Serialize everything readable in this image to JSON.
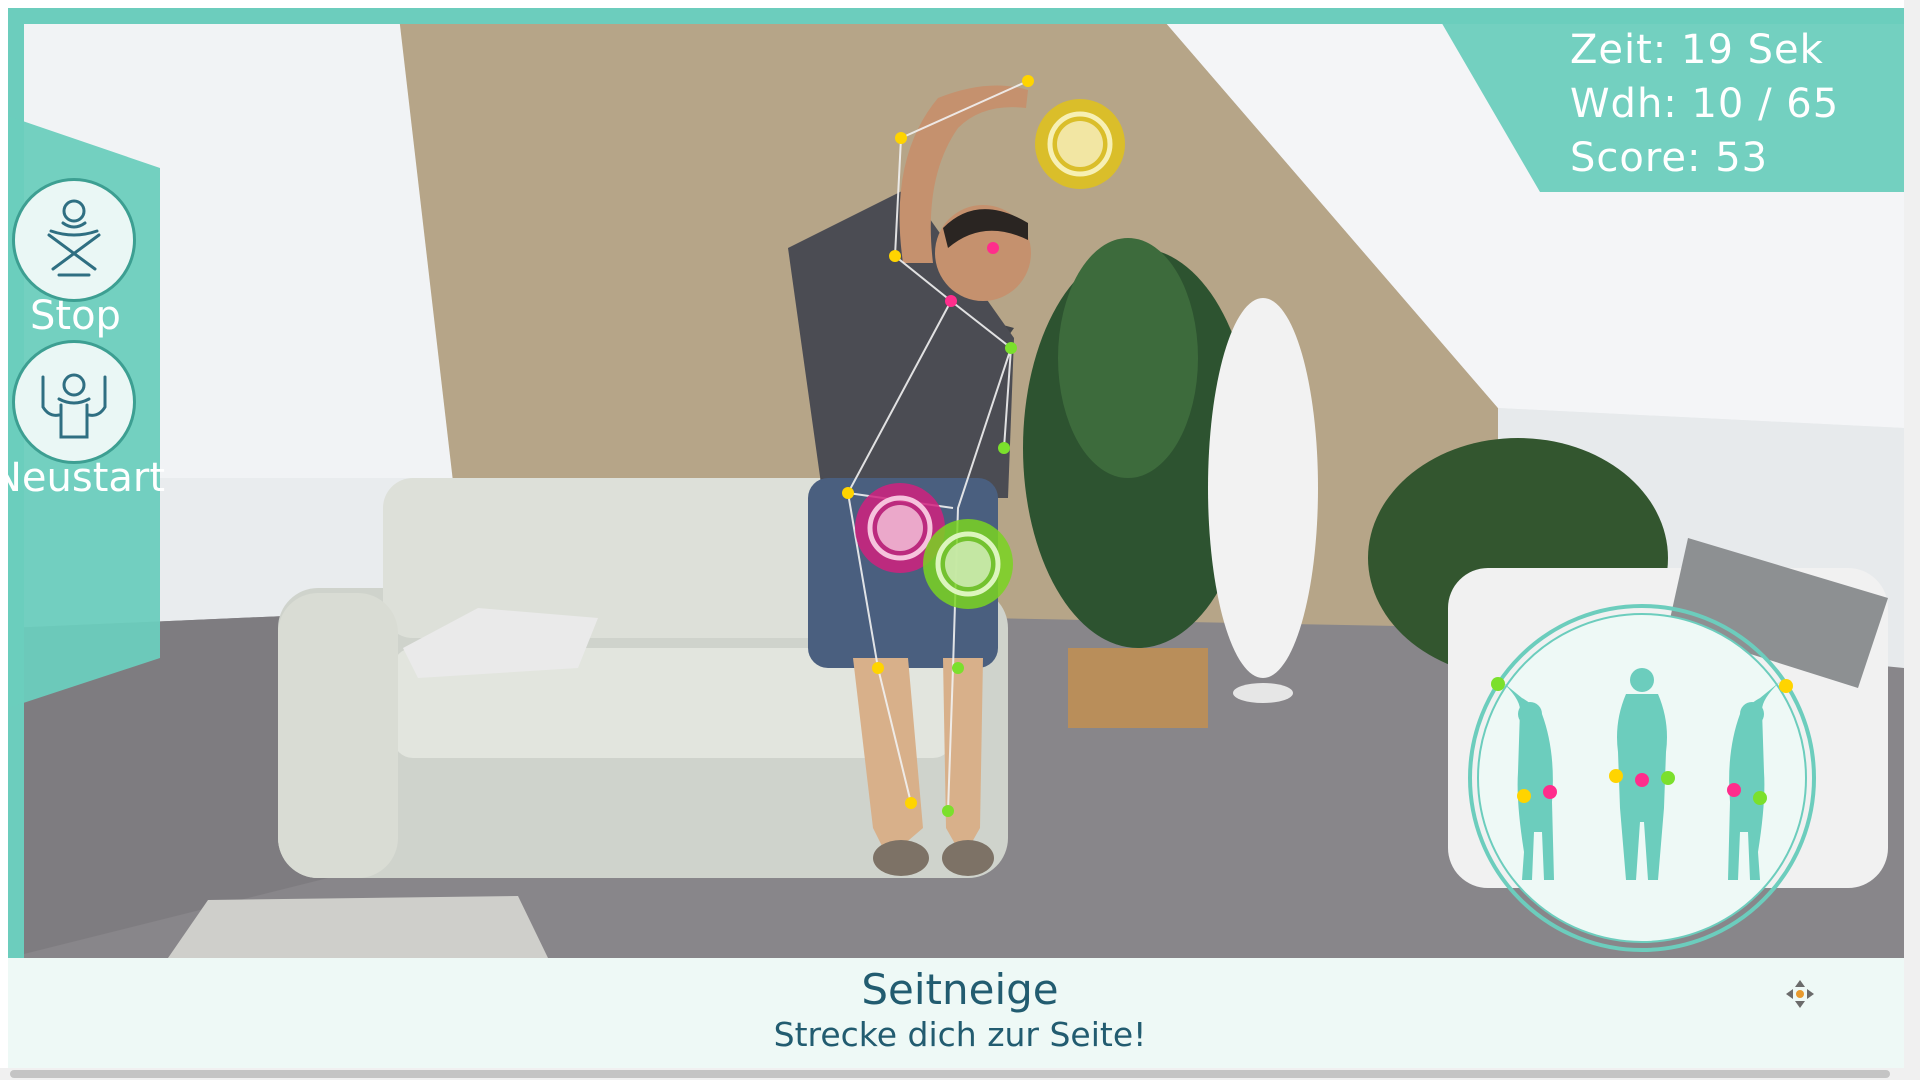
{
  "controls": {
    "stop_label": "Stop",
    "restart_label": "Neustart"
  },
  "stats": {
    "time": "Zeit: 19 Sek",
    "reps": "Wdh: 10 / 65",
    "score": "Score: 53"
  },
  "exercise": {
    "title": "Seitneige",
    "instruction": "Strecke dich zur Seite!"
  },
  "targets": [
    {
      "name": "target-yellow",
      "color": "#e0c21a"
    },
    {
      "name": "target-pink",
      "color": "#d0217e"
    },
    {
      "name": "target-green",
      "color": "#7ad321"
    }
  ],
  "colors": {
    "accent": "#6ccdbd",
    "caption_text": "#225c70"
  },
  "icons": {
    "stop": "crossed-arms-icon",
    "restart": "raised-arms-icon",
    "move": "move-arrows-icon"
  }
}
